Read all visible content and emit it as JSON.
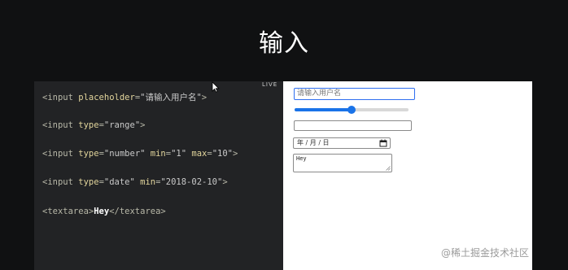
{
  "slide": {
    "title": "输入"
  },
  "code_lines": [
    {
      "pre": "<input ",
      "attr1": "placeholder",
      "eq1": "=",
      "val1": "\"请输入用户名\"",
      "post": ">"
    },
    {
      "pre": "<input ",
      "attr1": "type",
      "eq1": "=",
      "val1": "\"range\"",
      "post": ">"
    },
    {
      "pre": "<input ",
      "attr1": "type",
      "eq1": "=",
      "val1": "\"number\"",
      "attr2": " min",
      "eq2": "=",
      "val2": "\"1\"",
      "attr3": " max",
      "eq3": "=",
      "val3": "\"10\"",
      "post": ">"
    },
    {
      "pre": "<input ",
      "attr1": "type",
      "eq1": "=",
      "val1": "\"date\"",
      "attr2": " min",
      "eq2": "=",
      "val2": "\"2018-02-10\"",
      "post": ">"
    },
    {
      "pre": "<textarea>",
      "text": "Hey",
      "post": "</textarea>"
    }
  ],
  "live_label": "LIVE",
  "preview": {
    "text_placeholder": "请输入用户名",
    "range_value": 0.5,
    "date_placeholder": "年 / 月 / 日",
    "textarea_value": "Hey",
    "accent_color": "#1a73e8"
  },
  "watermark": "@稀土掘金技术社区"
}
